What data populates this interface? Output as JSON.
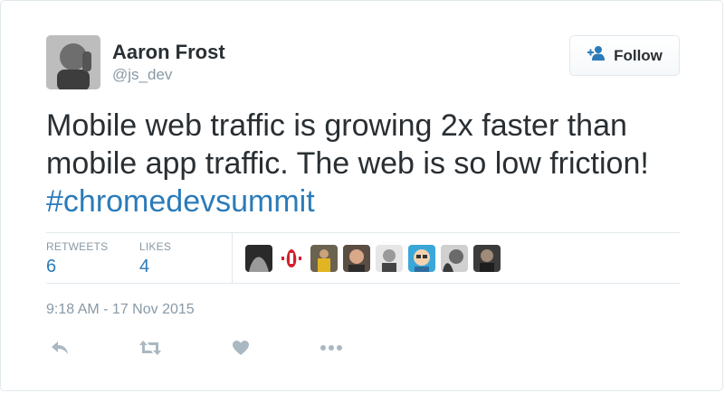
{
  "author": {
    "name": "Aaron Frost",
    "handle": "@js_dev",
    "avatar_icon": "user-avatar-photo"
  },
  "follow_button": {
    "label": "Follow",
    "icon": "add-user-icon"
  },
  "tweet": {
    "text": "Mobile web traffic is growing 2x faster than mobile app traffic. The web is so low friction! ",
    "hashtag": "#chromedevsummit"
  },
  "stats": {
    "retweets_label": "RETWEETS",
    "retweets_value": "6",
    "likes_label": "LIKES",
    "likes_value": "4"
  },
  "likers": [
    "liker-avatar-1",
    "liker-avatar-2",
    "liker-avatar-3",
    "liker-avatar-4",
    "liker-avatar-5",
    "liker-avatar-6",
    "liker-avatar-7",
    "liker-avatar-8"
  ],
  "timestamp": "9:18 AM - 17 Nov 2015",
  "actions": [
    "reply-icon",
    "retweet-icon",
    "like-icon",
    "more-icon"
  ],
  "colors": {
    "link": "#2b7bb9",
    "muted": "#8899a6",
    "text": "#292f33",
    "border": "#e1e8ed"
  }
}
